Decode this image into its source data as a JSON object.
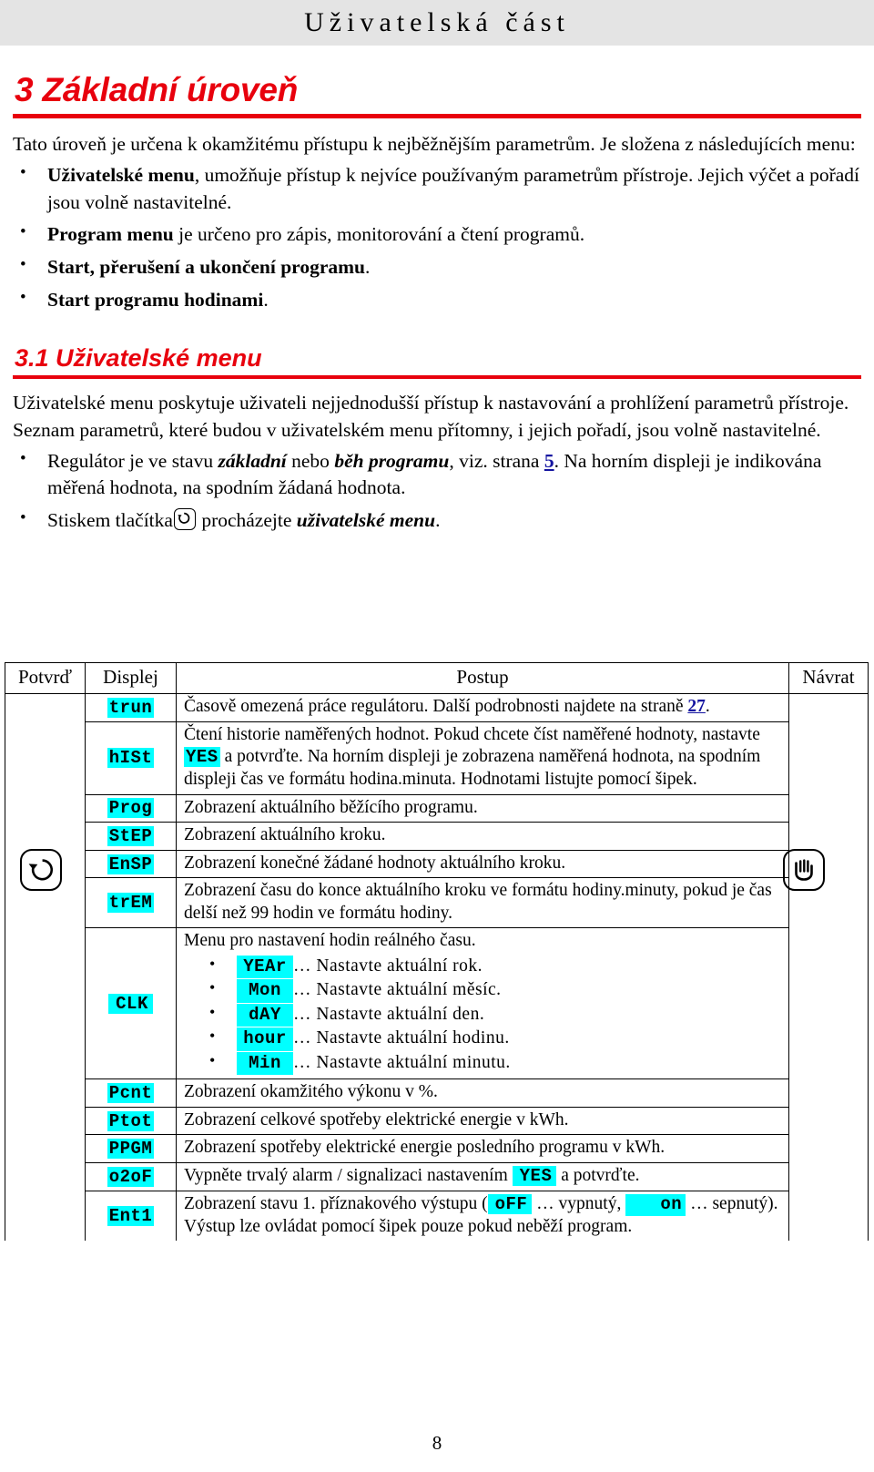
{
  "header": {
    "running_title": "Uživatelská část"
  },
  "chapter": {
    "title": "3 Základní úroveň",
    "intro": "Tato úroveň je určena k okamžitému přístupu k nejběžnějším parametrům. Je složena z následujících menu:",
    "bullets": [
      {
        "bold": "Uživatelské menu",
        "rest": ", umožňuje přístup k nejvíce používaným parametrům přístroje. Jejich výčet a pořadí jsou volně nastavitelné."
      },
      {
        "bold": "Program menu",
        "rest": " je určeno pro zápis, monitorování a čtení programů."
      },
      {
        "bold": "Start, přerušení a ukončení programu",
        "rest": "."
      },
      {
        "bold": "Start programu hodinami",
        "rest": "."
      }
    ]
  },
  "section": {
    "title": "3.1 Uživatelské menu",
    "intro": "Uživatelské menu poskytuje uživateli nejjednodušší přístup k nastavování a prohlížení parametrů přístroje. Seznam parametrů, které budou v uživatelském menu přítomny, i jejich pořadí, jsou volně nastavitelné.",
    "bullet_1": {
      "pre": "Regulátor je ve stavu ",
      "em1": "základní",
      "mid": " nebo ",
      "em2": "běh programu",
      "mid2": ", viz. strana ",
      "link": "5",
      "post": ". Na horním displeji je indikována měřená hodnota, na spodním žádaná hodnota."
    },
    "bullet_2": {
      "pre": "Stiskem tlačítka",
      "mid": " procházejte ",
      "em": "uživatelské menu",
      "post": "."
    }
  },
  "table": {
    "headers": {
      "confirm": "Potvrď",
      "display": "Displej",
      "steps": "Postup",
      "back": "Návrat"
    },
    "rows": [
      {
        "code": "trun",
        "text_pre": "Časově omezená práce regulátoru. Další podrobnosti najdete na straně ",
        "link": "27",
        "text_post": "."
      },
      {
        "code": "hISt",
        "seg1": "Čtení historie naměřených hodnot. Pokud chcete číst naměřené hodnoty, nastavte ",
        "chip": "YES",
        "seg2": " a potvrďte. Na horním displeji je zobrazena naměřená hodnota, na spodním displeji čas ve formátu hodina.minuta. Hodnotami listujte pomocí šipek."
      },
      {
        "code": "Prog",
        "text": "Zobrazení aktuálního běžícího programu."
      },
      {
        "code": "StEP",
        "text": "Zobrazení aktuálního kroku."
      },
      {
        "code": "EnSP",
        "text": "Zobrazení konečné žádané hodnoty aktuálního kroku."
      },
      {
        "code": "trEM",
        "text": "Zobrazení času do konce aktuálního kroku ve formátu hodiny.minuty, pokud je čas delší než 99 hodin ve formátu hodiny."
      },
      {
        "code": "CLK",
        "intro": "Menu pro nastavení hodin reálného času.",
        "subitems": [
          {
            "chip": "YEAr",
            "text": "… Nastavte aktuální rok."
          },
          {
            "chip": "Mon",
            "text": "… Nastavte aktuální měsíc."
          },
          {
            "chip": "dAY",
            "text": "… Nastavte aktuální den."
          },
          {
            "chip": "hour",
            "text": "… Nastavte aktuální hodinu."
          },
          {
            "chip": "Min",
            "text": "… Nastavte aktuální minutu."
          }
        ]
      },
      {
        "code": "Pcnt",
        "text": "Zobrazení okamžitého výkonu v %."
      },
      {
        "code": "Ptot",
        "text": "Zobrazení celkové spotřeby elektrické energie v kWh."
      },
      {
        "code": "PPGM",
        "text": "Zobrazení spotřeby elektrické energie posledního programu v kWh."
      },
      {
        "code": "o2oF",
        "seg1": "Vypněte trvalý alarm / signalizaci nastavením ",
        "chip": "YES",
        "seg2": " a potvrďte."
      },
      {
        "code": "Ent1",
        "seg1": "Zobrazení stavu 1. příznakového výstupu (",
        "chip1": "oFF",
        "seg2": " … vypnutý, ",
        "chip2": "on",
        "seg3": " … sepnutý). Výstup lze ovládat pomocí šipek pouze pokud neběží program."
      }
    ]
  },
  "icons": {
    "left_key": "loop-key-icon",
    "right_key": "hand-stop-key-icon",
    "inline_key": "loop-key-icon"
  },
  "footer": {
    "page_number": "8"
  },
  "colors": {
    "accent_red": "#e8000d",
    "highlight_cyan": "#00ffff",
    "header_band": "#e4e4e4",
    "link_blue": "#1414a0"
  }
}
